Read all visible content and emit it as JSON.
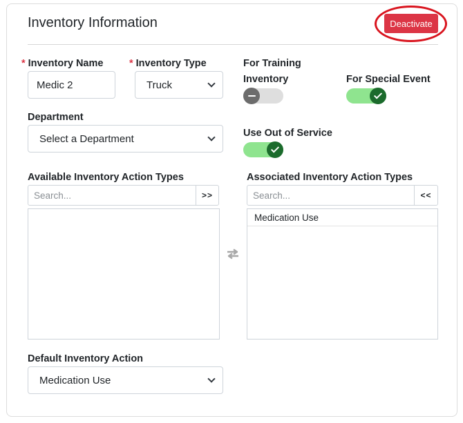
{
  "header": {
    "title": "Inventory Information",
    "deactivate_label": "Deactivate"
  },
  "form": {
    "inventory_name": {
      "label": "Inventory Name",
      "required_mark": "*",
      "value": "Medic 2"
    },
    "inventory_type": {
      "label": "Inventory Type",
      "required_mark": "*",
      "value": "Truck"
    },
    "for_training": {
      "label_line1": "For Training",
      "label_line2": "Inventory",
      "state": "off"
    },
    "for_special_event": {
      "label": "For Special Event",
      "state": "on"
    },
    "department": {
      "label": "Department",
      "value": "Select a Department"
    },
    "use_out_of_service": {
      "label": "Use Out of Service",
      "state": "on"
    },
    "available_types": {
      "label": "Available Inventory Action Types",
      "search_placeholder": "Search...",
      "move_label": ">>",
      "items": []
    },
    "associated_types": {
      "label": "Associated Inventory Action Types",
      "search_placeholder": "Search...",
      "move_label": "<<",
      "items": [
        "Medication Use"
      ]
    },
    "default_action": {
      "label": "Default Inventory Action",
      "value": "Medication Use"
    }
  },
  "colors": {
    "danger": "#dc3545",
    "toggle_on_track": "#8fe48f",
    "toggle_on_knob": "#1b6b2c",
    "toggle_off_track": "#dedede",
    "toggle_off_knob": "#6c6c6c",
    "highlight_ring": "#d9141e"
  },
  "icons": {
    "swap": "swap-arrows-icon",
    "select_caret": "chevron-down-icon",
    "toggle_off": "minus-icon",
    "toggle_on": "check-icon"
  }
}
